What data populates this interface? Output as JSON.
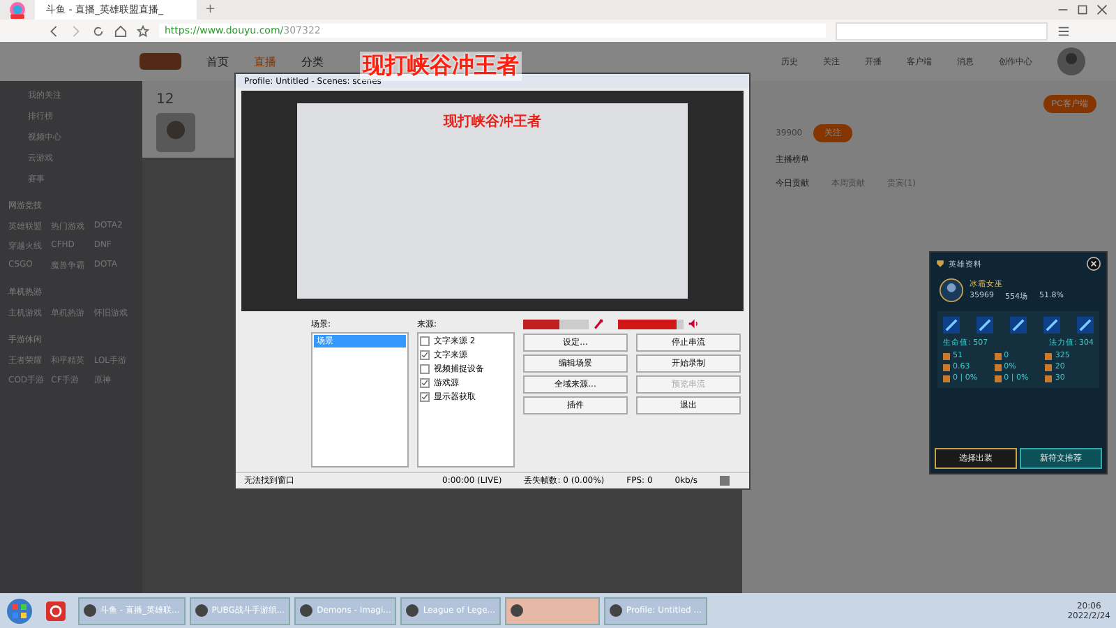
{
  "browser": {
    "tab_title": "斗鱼 - 直播_英雄联盟直播_",
    "new_tab": "+",
    "url_host": "https://www.douyu.com/",
    "url_path": "307322"
  },
  "site_nav": [
    {
      "label": "首页",
      "selected": false
    },
    {
      "label": "直播",
      "selected": true
    },
    {
      "label": "分类",
      "selected": false
    }
  ],
  "header_actions": [
    "历史",
    "关注",
    "开播",
    "客户端",
    "消息",
    "创作中心"
  ],
  "sidebar": {
    "links": [
      "我的关注",
      "排行榜",
      "视频中心",
      "云游戏",
      "赛事"
    ],
    "sections": [
      {
        "title": "网游竞技",
        "items": [
          "英雄联盟",
          "热门游戏",
          "DOTA2",
          "穿越火线",
          "CFHD",
          "DNF",
          "CSGO",
          "魔兽争霸",
          "DOTA"
        ]
      },
      {
        "title": "单机热游",
        "items": [
          "主机游戏",
          "单机热游",
          "怀旧游戏"
        ]
      },
      {
        "title": "手游休闲",
        "items": [
          "王者荣耀",
          "和平精英",
          "LOL手游",
          "COD手游",
          "CF手游",
          "原神"
        ]
      }
    ]
  },
  "streamer": {
    "count": "12"
  },
  "banner_title": "现打峡谷冲王者",
  "obs": {
    "title": "Profile: Untitled - Scenes: scenes",
    "preview_title": "现打峡谷冲王者",
    "scenes_label": "场景:",
    "scenes": [
      {
        "label": "场景",
        "selected": true
      }
    ],
    "sources_label": "来源:",
    "sources": [
      {
        "label": "文字来源 2",
        "checked": false
      },
      {
        "label": "文字来源",
        "checked": true
      },
      {
        "label": "视频捕捉设备",
        "checked": false
      },
      {
        "label": "游戏源",
        "checked": true
      },
      {
        "label": "显示器获取",
        "checked": true
      }
    ],
    "meters": [
      {
        "kind": "mic",
        "level": 0.55
      },
      {
        "kind": "speaker",
        "level": 0.9
      }
    ],
    "buttons": [
      {
        "label": "设定...",
        "disabled": false
      },
      {
        "label": "停止串流",
        "disabled": false
      },
      {
        "label": "编辑场景",
        "disabled": false
      },
      {
        "label": "开始录制",
        "disabled": false
      },
      {
        "label": "全域来源...",
        "disabled": false
      },
      {
        "label": "预览串流",
        "disabled": true
      },
      {
        "label": "插件",
        "disabled": false
      },
      {
        "label": "退出",
        "disabled": false
      }
    ],
    "status": [
      "无法找到窗口",
      "0:00:00 (LIVE)",
      "丢失帧数: 0 (0.00%)",
      "FPS: 0",
      "0kb/s"
    ]
  },
  "right_panel": {
    "client_button": "PC客户端",
    "fans": "39900",
    "follow": "关注",
    "rank_title": "主播榜单",
    "rank_tabs": [
      {
        "label": "今日贡献",
        "selected": true
      },
      {
        "label": "本周贡献",
        "selected": false
      },
      {
        "label": "贵宾(1)",
        "selected": false
      }
    ]
  },
  "hero_card": {
    "title": "英雄资料",
    "hero": "冰霜女巫",
    "games_total": "35969",
    "games": "554场",
    "win_rate": "51.8%",
    "hp": "生命值: 507",
    "mp": "法力值: 304",
    "stats": [
      "51",
      "0",
      "325",
      "0.63",
      "0%",
      "20",
      "0 | 0%",
      "0 | 0%",
      "30"
    ],
    "buttons": [
      "选择出装",
      "新符文推荐"
    ]
  },
  "taskbar": {
    "items": [
      {
        "label": "斗鱼 - 直播_英雄联...",
        "selected": false
      },
      {
        "label": "PUBG战斗手游组...",
        "selected": false
      },
      {
        "label": "Demons - Imagi...",
        "selected": false
      },
      {
        "label": "League of Lege...",
        "selected": false
      },
      {
        "selected": true
      },
      {
        "label": "Profile: Untitled ...",
        "selected": false
      }
    ],
    "time": "20:06",
    "date": "2022/2/24"
  }
}
